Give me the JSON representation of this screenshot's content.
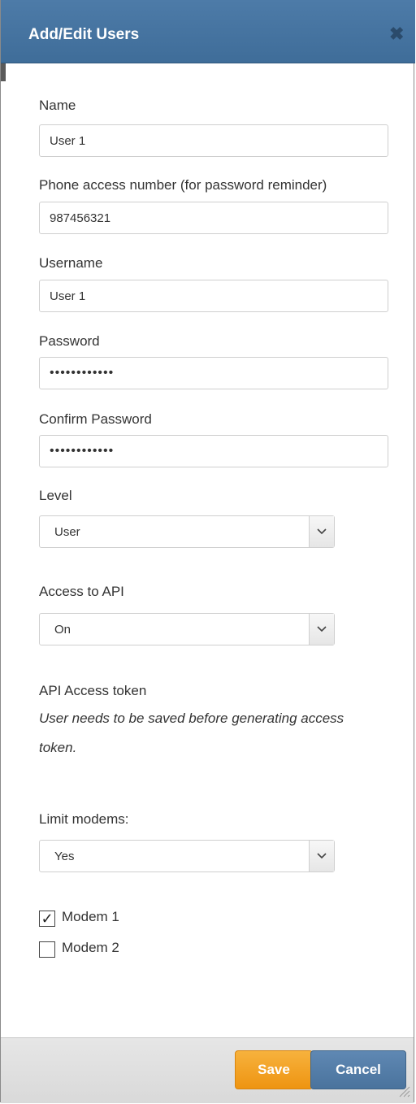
{
  "dialog": {
    "title": "Add/Edit Users",
    "close_symbol": "✖"
  },
  "form": {
    "name": {
      "label": "Name",
      "value": "User 1"
    },
    "phone": {
      "label": "Phone access number (for password reminder)",
      "value": "987456321"
    },
    "username": {
      "label": "Username",
      "value": "User 1"
    },
    "password": {
      "label": "Password",
      "value": "••••••••••••"
    },
    "confirm_password": {
      "label": "Confirm Password",
      "value": "••••••••••••"
    },
    "level": {
      "label": "Level",
      "selected": "User"
    },
    "api_access": {
      "label": "Access to API",
      "selected": "On"
    },
    "api_token": {
      "label": "API Access token",
      "note": "User needs to be saved before generating access token."
    },
    "limit_modems": {
      "label": "Limit modems:",
      "selected": "Yes"
    },
    "modems": [
      {
        "label": "Modem 1",
        "checked": true,
        "mark": "✓"
      },
      {
        "label": "Modem 2",
        "checked": false,
        "mark": ""
      }
    ]
  },
  "footer": {
    "save_label": "Save",
    "cancel_label": "Cancel"
  },
  "colors": {
    "titlebar": "#4775a2",
    "save_button": "#f2a024",
    "cancel_button": "#5580ab"
  },
  "icons": {
    "close": "close-icon",
    "dropdown": "chevron-down-icon",
    "check": "checkmark-icon"
  }
}
